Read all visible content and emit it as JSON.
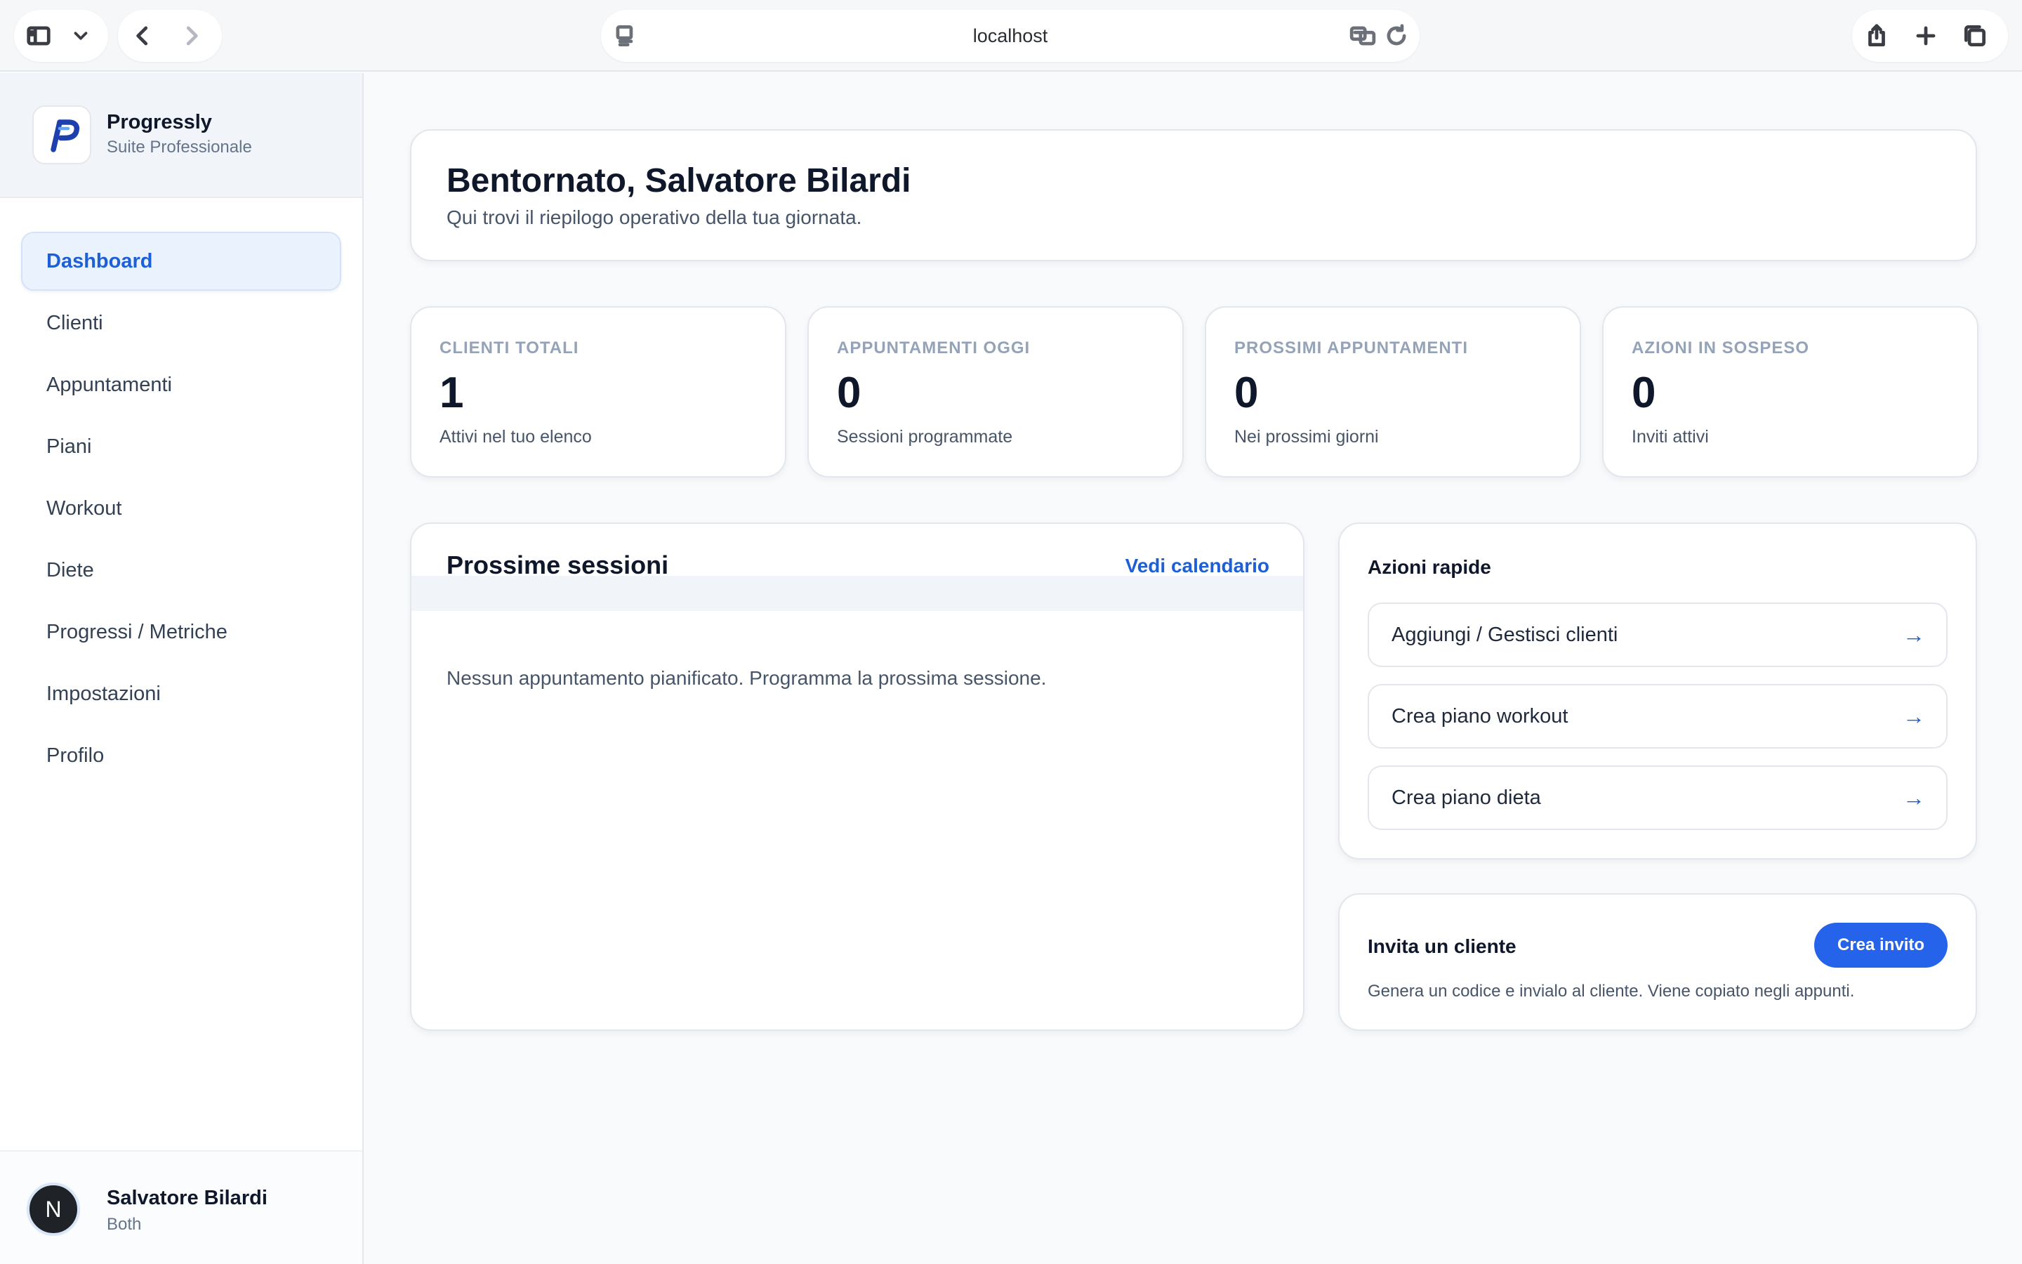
{
  "browser": {
    "url": "localhost"
  },
  "sidebar": {
    "brand_name": "Progressly",
    "brand_subtitle": "Suite Professionale",
    "items": [
      {
        "label": "Dashboard",
        "active": true
      },
      {
        "label": "Clienti"
      },
      {
        "label": "Appuntamenti"
      },
      {
        "label": "Piani"
      },
      {
        "label": "Workout"
      },
      {
        "label": "Diete"
      },
      {
        "label": "Progressi / Metriche"
      },
      {
        "label": "Impostazioni"
      },
      {
        "label": "Profilo"
      }
    ],
    "user": {
      "initial": "N",
      "name": "Salvatore Bilardi",
      "role": "Both"
    }
  },
  "welcome": {
    "title": "Bentornato, Salvatore Bilardi",
    "subtitle": "Qui trovi il riepilogo operativo della tua giornata."
  },
  "stats": [
    {
      "label": "CLIENTI TOTALI",
      "value": "1",
      "desc": "Attivi nel tuo elenco"
    },
    {
      "label": "APPUNTAMENTI OGGI",
      "value": "0",
      "desc": "Sessioni programmate"
    },
    {
      "label": "PROSSIMI APPUNTAMENTI",
      "value": "0",
      "desc": "Nei prossimi giorni"
    },
    {
      "label": "AZIONI IN SOSPESO",
      "value": "0",
      "desc": "Inviti attivi"
    }
  ],
  "sessions": {
    "title": "Prossime sessioni",
    "link": "Vedi calendario",
    "empty": "Nessun appuntamento pianificato. Programma la prossima sessione."
  },
  "quick_actions": {
    "title": "Azioni rapide",
    "arrow": "→",
    "items": [
      {
        "label": "Aggiungi / Gestisci clienti"
      },
      {
        "label": "Crea piano workout"
      },
      {
        "label": "Crea piano dieta"
      }
    ]
  },
  "invite": {
    "title": "Invita un cliente",
    "button": "Crea invito",
    "desc": "Genera un codice e invialo al cliente. Viene copiato negli appunti."
  },
  "colors": {
    "accent": "#1d5fd6",
    "button": "#2563eb",
    "background": "#f8fafc"
  }
}
